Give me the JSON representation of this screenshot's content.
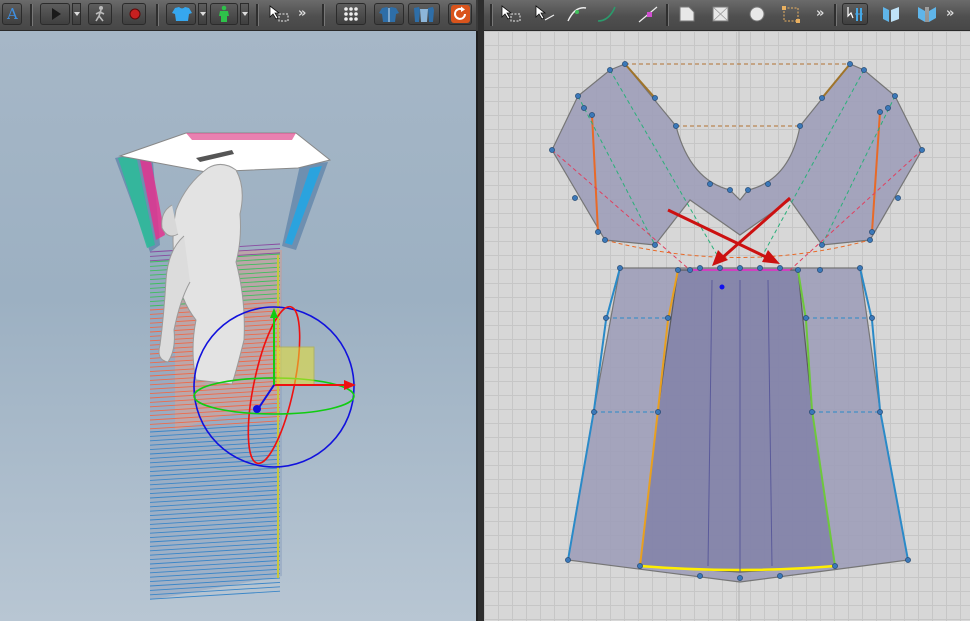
{
  "app_logo_letter": "A",
  "toolbar_left": {
    "buttons": [
      {
        "name": "app-menu-button",
        "icon": "letter-a-icon"
      },
      {
        "name": "play-simulation-button",
        "icon": "play-icon"
      },
      {
        "name": "walk-animation-button",
        "icon": "walking-avatar-icon"
      },
      {
        "name": "record-button",
        "icon": "record-icon"
      },
      {
        "name": "show-garment-button",
        "icon": "shirt-icon"
      },
      {
        "name": "show-avatar-button",
        "icon": "avatar-icon"
      },
      {
        "name": "select-move-button",
        "icon": "select-arrow-icon"
      },
      {
        "name": "arrangement-points-button",
        "icon": "grid-dots-icon"
      },
      {
        "name": "garment-view-button",
        "icon": "garment-front-icon"
      },
      {
        "name": "avatar-view-button",
        "icon": "avatar-pair-icon"
      },
      {
        "name": "reset-view-button",
        "icon": "refresh-icon"
      }
    ],
    "overflow": "»"
  },
  "toolbar_right": {
    "buttons": [
      {
        "name": "transform-pattern-button",
        "icon": "transform-arrow-icon"
      },
      {
        "name": "edit-pattern-button",
        "icon": "edit-arrow-icon"
      },
      {
        "name": "edit-curvature-button",
        "icon": "curve-icon"
      },
      {
        "name": "edit-curve-point-button",
        "icon": "curve-point-icon"
      },
      {
        "name": "add-point-button",
        "icon": "add-point-icon"
      },
      {
        "name": "polygon-tool-button",
        "icon": "polygon-icon"
      },
      {
        "name": "rectangle-tool-button",
        "icon": "rectangle-icon"
      },
      {
        "name": "circle-tool-button",
        "icon": "circle-icon"
      },
      {
        "name": "internal-rectangle-button",
        "icon": "internal-rect-icon"
      },
      {
        "name": "segment-sewing-button",
        "icon": "sewing-icon"
      },
      {
        "name": "fold-arrangement-button",
        "icon": "fold-icon"
      },
      {
        "name": "fold-angle-button",
        "icon": "fold-angle-icon"
      }
    ],
    "overflow_1": "»",
    "overflow_2": "»"
  },
  "colors": {
    "toolbar_bg": "#555555",
    "viewport3d_bg": "#a6b7c7",
    "viewport2d_bg": "#d7d7d7",
    "pattern_fill": "#9c9cb8",
    "gizmo_blue": "#1111dd",
    "gizmo_red": "#ee1111",
    "gizmo_green": "#11cc11",
    "annotation_arrow": "#cc1111",
    "hem_highlight": "#ffee00"
  }
}
